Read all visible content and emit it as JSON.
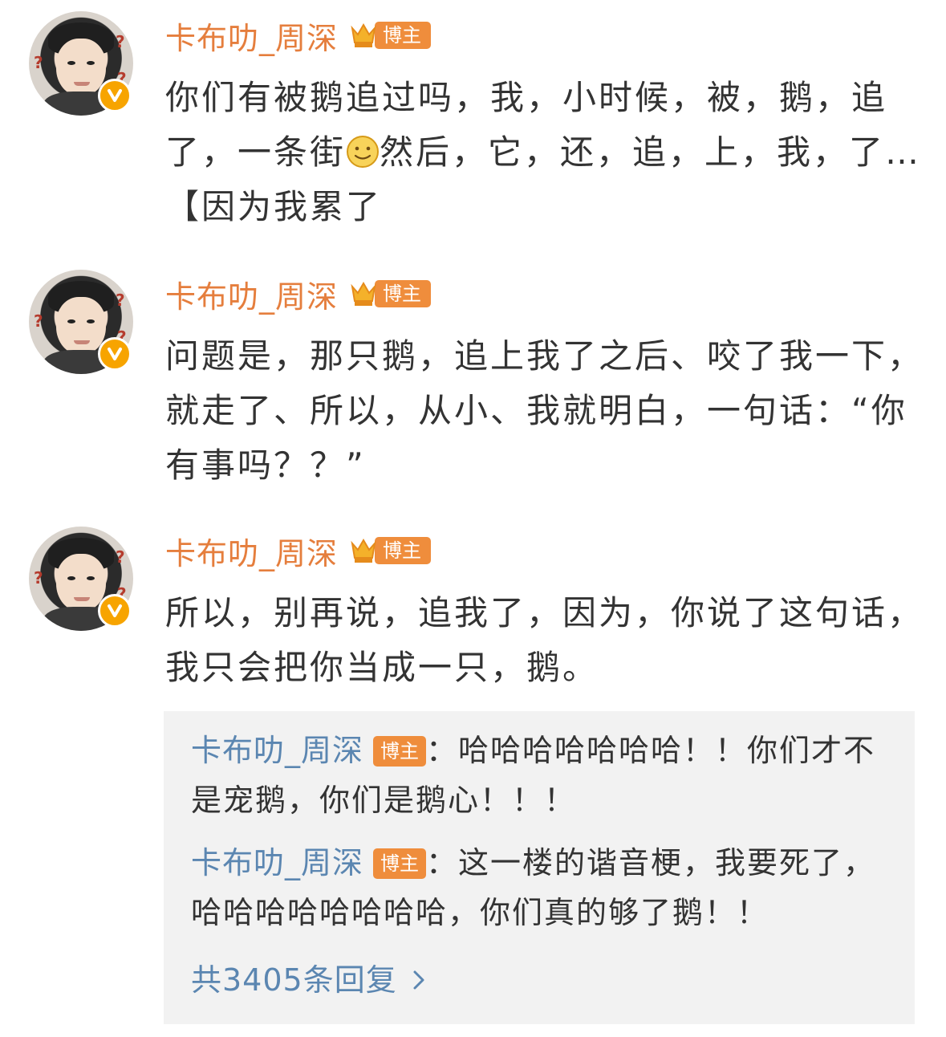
{
  "colors": {
    "username": "#e57e3d",
    "badge": "#ef8d3c",
    "reply_name": "#5b86b1",
    "text": "#333333",
    "reply_background": "#f2f2f2",
    "verified": "#f7a400"
  },
  "posts": [
    {
      "username": "卡布叻_周深",
      "badge": "博主",
      "text_before_emoji": "你们有被鹅追过吗，我，小时候，被，鹅，追了，一条街",
      "emoji": "smile-emoji",
      "text_after_emoji": "然后，它，还，追，上，我，了…【因为我累了"
    },
    {
      "username": "卡布叻_周深",
      "badge": "博主",
      "text": "问题是，那只鹅，追上我了之后、咬了我一下，就走了、所以，从小、我就明白，一句话：“你有事吗？？”"
    },
    {
      "username": "卡布叻_周深",
      "badge": "博主",
      "text": "所以，别再说，追我了，因为，你说了这句话，我只会把你当成一只，鹅。"
    }
  ],
  "replies": [
    {
      "name": "卡布叻_周深",
      "badge": "博主",
      "text": "：哈哈哈哈哈哈哈！！你们才不是宠鹅，你们是鹅心！！！"
    },
    {
      "name": "卡布叻_周深",
      "badge": "博主",
      "text": "：这一楼的谐音梗，我要死了，哈哈哈哈哈哈哈哈，你们真的够了鹅！！"
    }
  ],
  "more_replies": "共3405条回复",
  "more_icon": "chevron-right-icon"
}
